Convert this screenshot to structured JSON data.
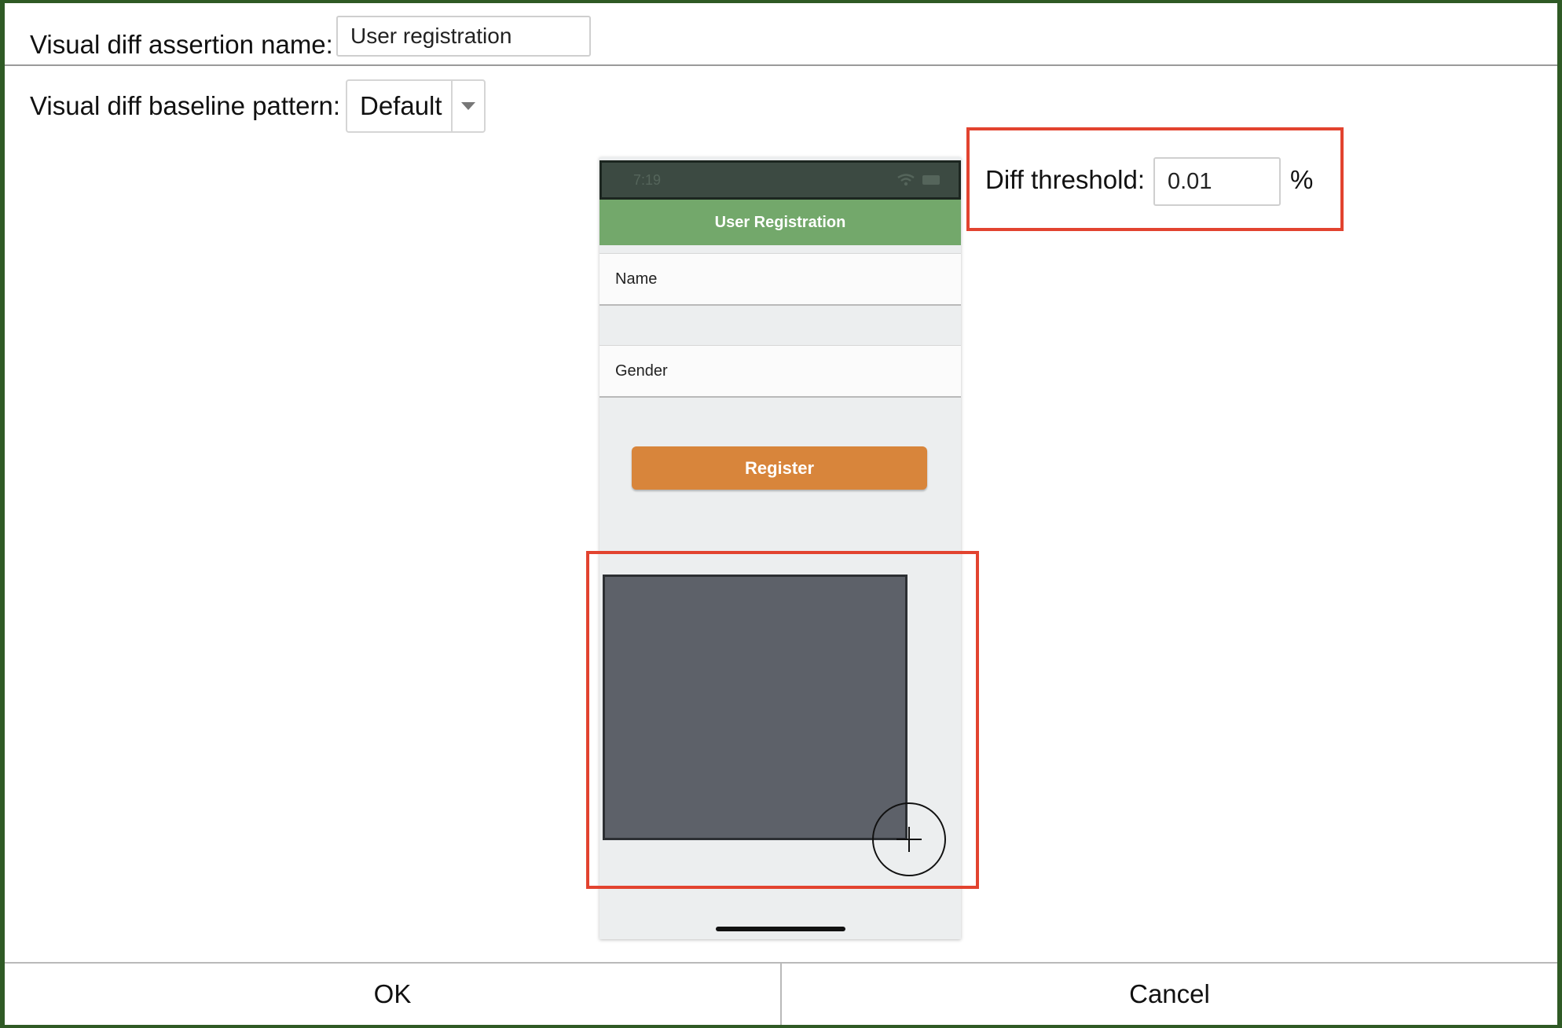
{
  "form": {
    "assertion_name_label": "Visual diff assertion name:",
    "assertion_name_value": "User registration",
    "baseline_pattern_label": "Visual diff baseline pattern:",
    "baseline_pattern_value": "Default",
    "diff_threshold_label": "Diff threshold:",
    "diff_threshold_value": "0.01",
    "diff_threshold_unit": "%"
  },
  "phone": {
    "status_time": "7:19",
    "nav_title": "User Registration",
    "name_field_label": "Name",
    "gender_field_label": "Gender",
    "register_button": "Register"
  },
  "footer": {
    "ok_label": "OK",
    "cancel_label": "Cancel"
  },
  "colors": {
    "highlight": "#e2432f",
    "nav_bar": "#73a86b",
    "register_button": "#d8853b",
    "ignore_region": "#5d6169"
  }
}
